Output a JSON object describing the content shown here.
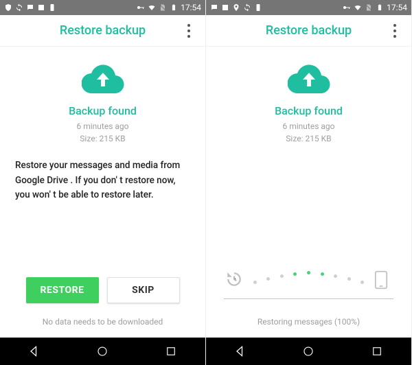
{
  "statusbar": {
    "time": "17:54"
  },
  "header": {
    "title": "Restore backup"
  },
  "backup": {
    "found_label": "Backup found",
    "age": "6 minutes ago",
    "size": "Size: 215 KB"
  },
  "left": {
    "description": "Restore your messages and media from Google Drive . If you don' t restore now, you won' t be able to restore later.",
    "restore_btn": "RESTORE",
    "skip_btn": "SKIP",
    "footnote": "No data needs to be downloaded"
  },
  "right": {
    "status": "Restoring messages (100%)"
  },
  "colors": {
    "accent_teal": "#1fbea0",
    "accent_green": "#3ecf5e"
  }
}
